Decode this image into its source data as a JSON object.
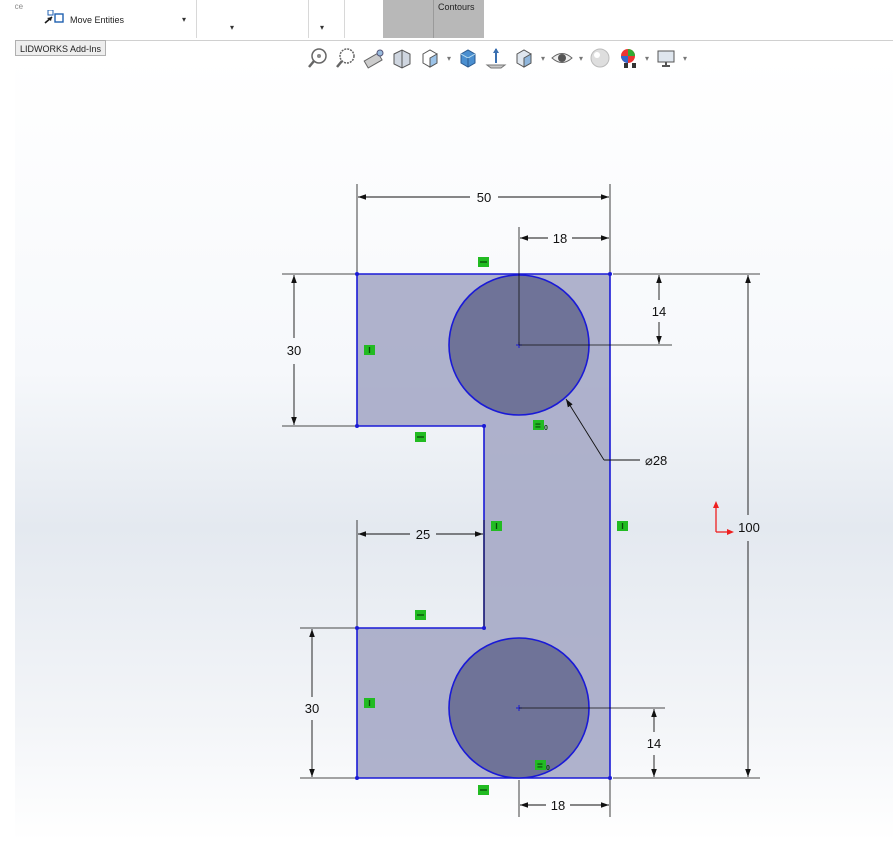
{
  "ribbon": {
    "face_label": "face",
    "move_entities_label": "Move Entities",
    "contours_label": "Contours",
    "dropdown_caret": "▾"
  },
  "tabs": {
    "addins_label": "LIDWORKS Add-Ins"
  },
  "heads_up_toolbar": {
    "items": [
      "zoom-to-fit",
      "zoom-to-area",
      "previous-view",
      "section-view",
      "view-orientation",
      "display-style",
      "hide-show-items",
      "edit-appearance",
      "apply-scene",
      "view-settings"
    ]
  },
  "colors": {
    "sketch_fill": "#a6aac6",
    "circle_fill": "#6f7398",
    "sketch_line": "#1a1ad6",
    "relation_green": "#22bb22",
    "dimension": "#111111",
    "origin_red": "#ee2020"
  },
  "dimensions": {
    "top_width": "50",
    "top_circle_offset": "18",
    "top_circle_depth": "14",
    "upper_height": "30",
    "circle_diameter": "⌀28",
    "overall_height": "100",
    "notch_width": "25",
    "lower_height": "30",
    "bottom_circle_height": "14",
    "bottom_circle_offset": "18"
  },
  "relations": {
    "equal_label": "=",
    "equal_subscript": "0"
  }
}
